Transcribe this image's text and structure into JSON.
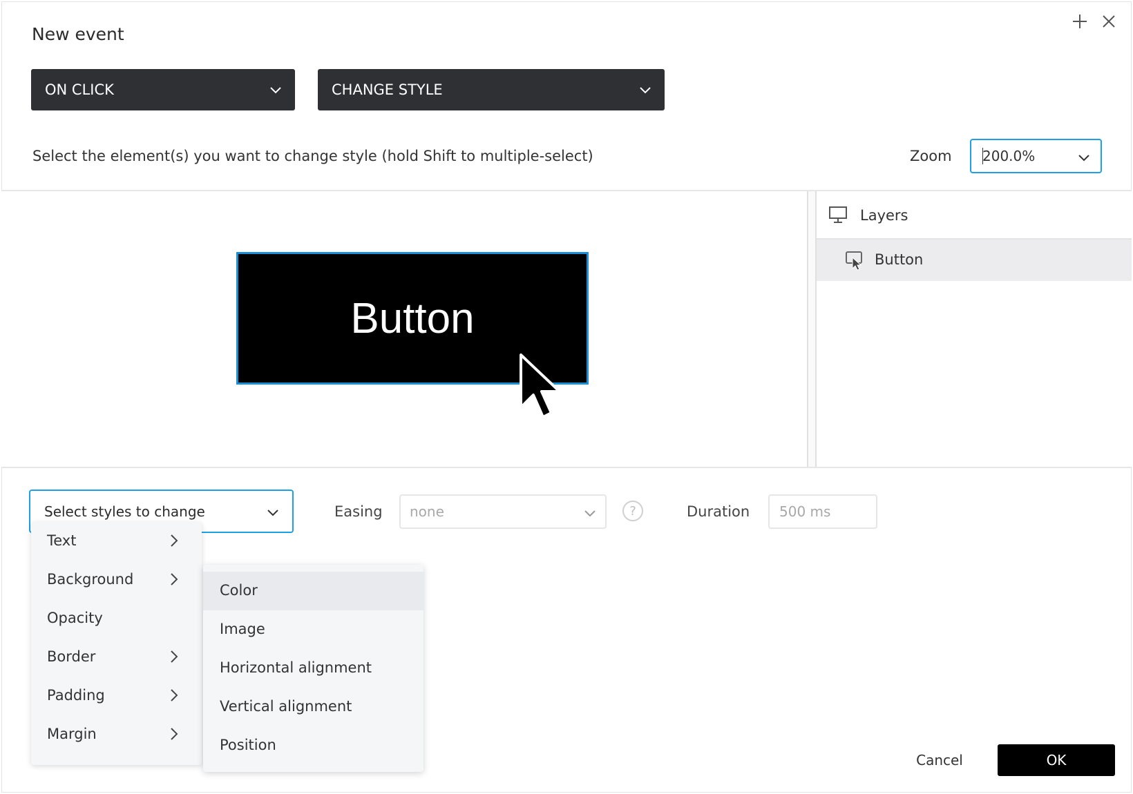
{
  "dialog": {
    "title": "New event",
    "top_icons": [
      "plus-icon",
      "close-icon"
    ]
  },
  "event_select": {
    "value": "ON CLICK"
  },
  "action_select": {
    "value": "CHANGE STYLE"
  },
  "instruction": "Select the element(s) you want to change style (hold Shift to multiple-select)",
  "zoom": {
    "label": "Zoom",
    "value": "200.0%"
  },
  "canvas": {
    "button_text": "Button"
  },
  "layers": {
    "header": "Layers",
    "items": [
      {
        "label": "Button",
        "icon": "button-layer-icon"
      }
    ]
  },
  "styles_select": {
    "placeholder": "Select styles to change"
  },
  "easing": {
    "label": "Easing",
    "value": "none"
  },
  "duration": {
    "label": "Duration",
    "value": "500 ms"
  },
  "style_menu": {
    "items": [
      {
        "label": "Text",
        "has_submenu": true
      },
      {
        "label": "Background",
        "has_submenu": true
      },
      {
        "label": "Opacity",
        "has_submenu": false
      },
      {
        "label": "Border",
        "has_submenu": true
      },
      {
        "label": "Padding",
        "has_submenu": true
      },
      {
        "label": "Margin",
        "has_submenu": true
      }
    ]
  },
  "background_submenu": {
    "items": [
      {
        "label": "Color"
      },
      {
        "label": "Image"
      },
      {
        "label": "Horizontal alignment"
      },
      {
        "label": "Vertical alignment"
      },
      {
        "label": "Position"
      }
    ]
  },
  "footer": {
    "cancel_label": "Cancel",
    "ok_label": "OK"
  },
  "colors": {
    "accent": "#1ea0e6",
    "dark_select": "#2f3033",
    "primary_button": "#000000"
  }
}
